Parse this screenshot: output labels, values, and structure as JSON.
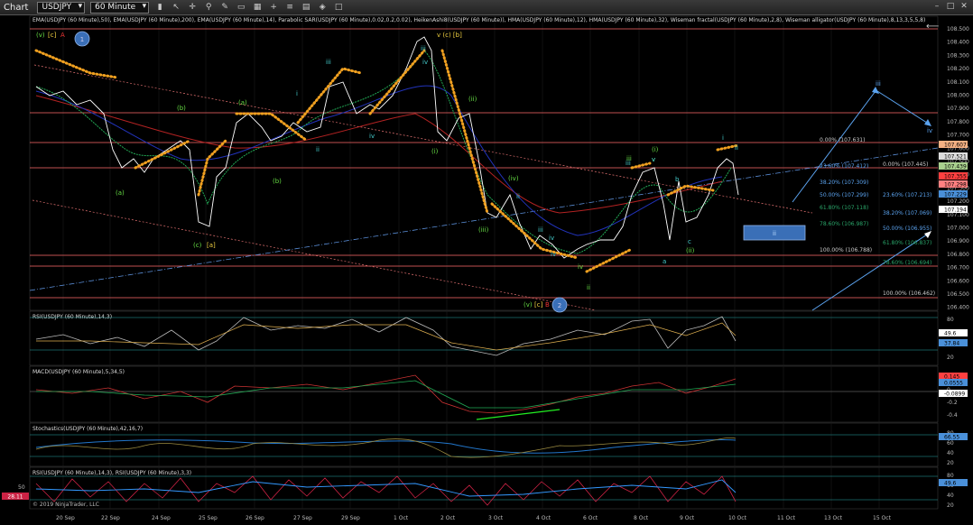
{
  "toolbar": {
    "app_label": "Chart",
    "instrument": "USDJPY",
    "interval": "60 Minute",
    "tool_icons": [
      "bar-type-icon",
      "pointer-icon",
      "crosshair-icon",
      "zoom-icon",
      "draw-icon",
      "text-icon",
      "grid-icon",
      "plus-icon",
      "properties-icon",
      "properties-icon",
      "layout-icon",
      "strategy-icon",
      "window-icon"
    ]
  },
  "window_buttons": [
    "minimize-icon",
    "maximize-icon",
    "close-icon"
  ],
  "price_panel": {
    "indicator_title": "EMA(USDJPY (60 Minute),50), EMA(USDJPY (60 Minute),200), EMA(USDJPY (60 Minute),14), Parabolic SAR(USDJPY (60 Minute),0.02,0.2,0.02), HeikenAshi8(USDJPY (60 Minute)), HMA(USDJPY (60 Minute),12), HMA(USDJPY (60 Minute),32), Wiseman fractal(USDJPY (60 Minute),2,8), Wiseman alligator(USDJPY (60 Minute),8,13,3,5,5,8)",
    "price_ticks": [
      "108.500",
      "108.400",
      "108.300",
      "108.200",
      "108.100",
      "108.000",
      "107.900",
      "107.800",
      "107.700",
      "107.600",
      "107.500",
      "107.400",
      "107.300",
      "107.200",
      "107.100",
      "107.000",
      "106.900",
      "106.800",
      "106.700",
      "106.600",
      "106.500",
      "106.400"
    ],
    "price_badges": [
      {
        "text": "107.607",
        "color": "#f4b183"
      },
      {
        "text": "107.521",
        "color": "#dddddd"
      },
      {
        "text": "107.439",
        "color": "#a9d08e"
      },
      {
        "text": "107.355",
        "color": "#ff4040"
      },
      {
        "text": "107.298",
        "color": "#ff8080"
      },
      {
        "text": "107.229",
        "color": "#4a90d9"
      },
      {
        "text": "107.194",
        "color": "#ffffff"
      }
    ],
    "fib_labels": [
      "0.00% (107.631)",
      "38.20% (107.309)",
      "50.00% (107.299)",
      "61.80% (107.118)",
      "78.60% (106.987)",
      "100.00% (106.788)",
      "0.00% (107.445)",
      "23.60% (107.213)",
      "38.20% (107.069)",
      "50.00% (106.955)",
      "61.80% (106.837)",
      "78.60% (106.694)",
      "100.00% (106.462)",
      "23.60% (107.412)"
    ],
    "wave_labels_green": [
      "(v)",
      "(b)",
      "(a)",
      "(c)",
      "(a)",
      "(b)",
      "(i)",
      "(ii)",
      "(iv)",
      "(iii)",
      "(v)",
      "(i)",
      "(ii)",
      "v",
      "iii",
      "iv",
      "ii"
    ],
    "wave_labels_yellow": [
      "[c]",
      "[a]",
      "v (c) [b]",
      "[c]"
    ],
    "wave_labels_cyan": [
      "i",
      "iii",
      "iv",
      "ii",
      "iii",
      "iv",
      "ii",
      "iii",
      "iv",
      "v",
      "b",
      "c",
      "a",
      "i",
      "ii",
      "iii",
      "iv"
    ],
    "wave_labels_red": [
      "A",
      "B"
    ],
    "circle_labels": [
      "1",
      "2"
    ]
  },
  "rsi_panel": {
    "title": "RSI(USDJPY (60 Minute),14,3)",
    "ticks": [
      "80",
      "60",
      "40",
      "20"
    ],
    "badges": [
      {
        "text": "49.6",
        "color": "#ffffff"
      },
      {
        "text": "37.84",
        "color": "#4a90d9"
      }
    ]
  },
  "macd_panel": {
    "title": "MACD(USDJPY (60 Minute),5,34,5)",
    "ticks": [
      "0.2",
      "0",
      "-0.2",
      "-0.4"
    ],
    "badges": [
      {
        "text": "0.145",
        "color": "#ff4040"
      },
      {
        "text": "0.0555",
        "color": "#4a90d9"
      },
      {
        "text": "-0.0899",
        "color": "#ffffff"
      }
    ]
  },
  "stoch_panel": {
    "title": "Stochastics(USDJPY (60 Minute),42,16,7)",
    "ticks": [
      "80",
      "60",
      "40",
      "20"
    ],
    "badges": [
      {
        "text": "66.55",
        "color": "#4a90d9"
      }
    ]
  },
  "rsi2_panel": {
    "title": "RSI(USDJPY (60 Minute),14,3), RSI(USDJPY (60 Minute),3,3)",
    "ticks": [
      "80",
      "60",
      "40",
      "20"
    ],
    "left_ticks": [
      "50"
    ],
    "left_badge": "28.11",
    "badges": [
      {
        "text": "49.6",
        "color": "#4a90d9"
      }
    ]
  },
  "copyright": "© 2019 NinjaTrader, LLC",
  "date_ticks": [
    "20 Sep",
    "22 Sep",
    "24 Sep",
    "25 Sep",
    "26 Sep",
    "27 Sep",
    "29 Sep",
    "1 Oct",
    "2 Oct",
    "3 Oct",
    "4 Oct",
    "6 Oct",
    "8 Oct",
    "9 Oct",
    "10 Oct",
    "11 Oct",
    "13 Oct",
    "15 Oct"
  ]
}
